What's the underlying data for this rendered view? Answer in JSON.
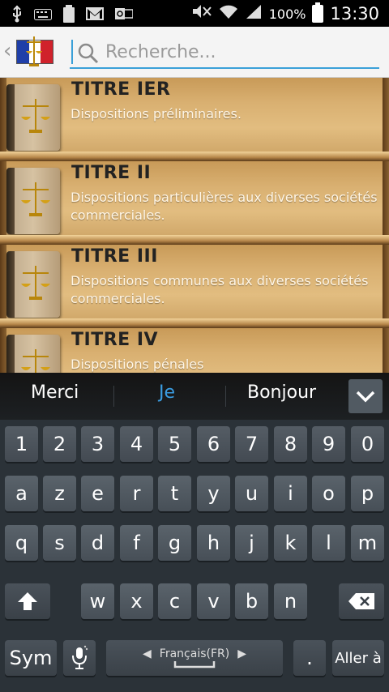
{
  "status_bar": {
    "battery_pct": "100%",
    "time": "13:30",
    "left_icons": [
      "usb-icon",
      "keyboard-icon",
      "battery-full-icon",
      "gmail-icon",
      "outlook-icon"
    ],
    "right_icons": [
      "mute-icon",
      "wifi-icon",
      "signal-icon",
      "battery-icon"
    ]
  },
  "header": {
    "search_placeholder": "Recherche...",
    "flag_colors": [
      "#1f3fa8",
      "#ffffff",
      "#d0222b"
    ]
  },
  "list": {
    "items": [
      {
        "title": "TITRE IER",
        "desc": "Dispositions préliminaires."
      },
      {
        "title": "TITRE II",
        "desc": "Dispositions particulières aux diverses sociétés commerciales."
      },
      {
        "title": "TITRE III",
        "desc": "Dispositions communes aux diverses sociétés commerciales."
      },
      {
        "title": "TITRE IV",
        "desc": "Dispositions pénales"
      }
    ]
  },
  "keyboard": {
    "suggestions": [
      "Merci",
      "Je",
      "Bonjour"
    ],
    "row_numbers": [
      "1",
      "2",
      "3",
      "4",
      "5",
      "6",
      "7",
      "8",
      "9",
      "0"
    ],
    "row1": [
      "a",
      "z",
      "e",
      "r",
      "t",
      "y",
      "u",
      "i",
      "o",
      "p"
    ],
    "row2": [
      "q",
      "s",
      "d",
      "f",
      "g",
      "h",
      "j",
      "k",
      "l",
      "m"
    ],
    "row3": [
      "w",
      "x",
      "c",
      "v",
      "b",
      "n"
    ],
    "sym_label": "Sym",
    "space_label": "Français(FR)",
    "enter_label": "Aller à",
    "period_label": "."
  },
  "colors": {
    "accent": "#3b9de2",
    "wood": "#d9b071"
  }
}
